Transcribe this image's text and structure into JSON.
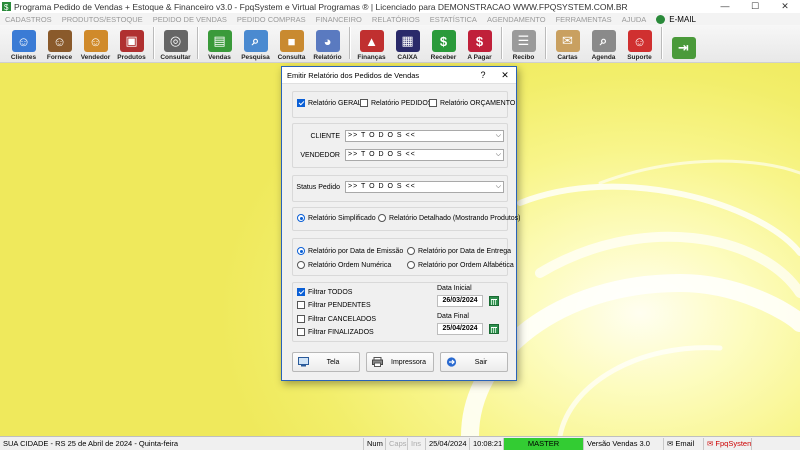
{
  "titlebar": {
    "title": "Programa Pedido de Vendas + Estoque & Financeiro v3.0 - FpqSystem e Virtual Programas ® | Licenciado para  DEMONSTRACAO WWW.FPQSYSTEM.COM.BR",
    "minimize": "—",
    "maximize": "☐",
    "close": "✕"
  },
  "menubar": {
    "items": [
      "CADASTROS",
      "PRODUTOS/ESTOQUE",
      "PEDIDO DE VENDAS",
      "PEDIDO COMPRAS",
      "FINANCEIRO",
      "RELATÓRIOS",
      "ESTATÍSTICA",
      "AGENDAMENTO",
      "FERRAMENTAS",
      "AJUDA"
    ],
    "email": "E-MAIL"
  },
  "toolbar": {
    "items": [
      {
        "label": "Clientes",
        "icon": "users-icon",
        "glyph": "☺",
        "color": "#3a7bd5"
      },
      {
        "label": "Fornece",
        "icon": "supplier-icon",
        "glyph": "☺",
        "color": "#8a5a2b"
      },
      {
        "label": "Vendedor",
        "icon": "salesman-icon",
        "glyph": "☺",
        "color": "#d08a2a"
      },
      {
        "label": "Produtos",
        "icon": "products-icon",
        "glyph": "▣",
        "color": "#b03030"
      },
      {
        "label": "Consultar",
        "icon": "consult-icon",
        "glyph": "◎",
        "color": "#666666"
      },
      {
        "label": "Vendas",
        "icon": "cart-icon",
        "glyph": "▤",
        "color": "#3a9a3a"
      },
      {
        "label": "Pesquisa",
        "icon": "search-doc-icon",
        "glyph": "⌕",
        "color": "#4a8ad0"
      },
      {
        "label": "Consulta",
        "icon": "box-icon",
        "glyph": "■",
        "color": "#c98a30"
      },
      {
        "label": "Relatório",
        "icon": "report-icon",
        "glyph": "◕",
        "color": "#5a7ac0"
      },
      {
        "label": "Finanças",
        "icon": "finance-icon",
        "glyph": "▲",
        "color": "#c03030"
      },
      {
        "label": "CAIXA",
        "icon": "cashbox-icon",
        "glyph": "▦",
        "color": "#2a2a6a"
      },
      {
        "label": "Receber",
        "icon": "receive-money-icon",
        "glyph": "$",
        "color": "#2a9a3a"
      },
      {
        "label": "A Pagar",
        "icon": "pay-money-icon",
        "glyph": "$",
        "color": "#c0203a"
      },
      {
        "label": "Recibo",
        "icon": "receipt-icon",
        "glyph": "☰",
        "color": "#9a9a9a"
      },
      {
        "label": "Cartas",
        "icon": "letters-icon",
        "glyph": "✉",
        "color": "#c9a060"
      },
      {
        "label": "Agenda",
        "icon": "agenda-icon",
        "glyph": "⌕",
        "color": "#8a8a8a"
      },
      {
        "label": "Suporte",
        "icon": "support-icon",
        "glyph": "☺",
        "color": "#d03030"
      },
      {
        "label": "",
        "icon": "exit-icon",
        "glyph": "⇥",
        "color": "#4a9a3a"
      }
    ]
  },
  "dialog": {
    "title": "Emitir Relatório dos Pedidos de Vendas",
    "help": "?",
    "close": "✕",
    "report_type": {
      "geral": "Relatório GERAL",
      "pedidos": "Relatório PEDIDOS",
      "orcamento": "Relatório ORÇAMENTO"
    },
    "cliente_label": "CLIENTE",
    "cliente_value": ">> T O D O S <<",
    "vendedor_label": "VENDEDOR",
    "vendedor_value": ">> T O D O S <<",
    "status_label": "Status Pedido",
    "status_value": ">> T O D O S <<",
    "detail": {
      "simplificado": "Relatório Simplificado",
      "detalhado": "Relatório Detalhado (Mostrando Produtos)"
    },
    "order": {
      "emissao": "Relatório por Data de Emissão",
      "entrega": "Relatório por Data de Entrega",
      "numerica": "Relatório Ordem Numérica",
      "alfabetica": "Relatório por Ordem Alfabética"
    },
    "filters": {
      "todos": "Filtrar TODOS",
      "pendentes": "Filtrar PENDENTES",
      "cancelados": "Filtrar CANCELADOS",
      "finalizados": "Filtrar FINALIZADOS"
    },
    "date_start_label": "Data Inicial",
    "date_start": "26/03/2024",
    "date_end_label": "Data Final",
    "date_end": "25/04/2024",
    "buttons": {
      "tela": "Tela",
      "impressora": "Impressora",
      "sair": "Sair"
    }
  },
  "statusbar": {
    "city": "SUA CIDADE - RS 25 de Abril de 2024 - Quinta-feira",
    "num": "Num",
    "caps": "Caps",
    "ins": "Ins",
    "date": "25/04/2024",
    "time": "10:08:21",
    "master": "MASTER",
    "version": "Versão Vendas 3.0",
    "email": "Email",
    "brand": "FpqSystem"
  }
}
